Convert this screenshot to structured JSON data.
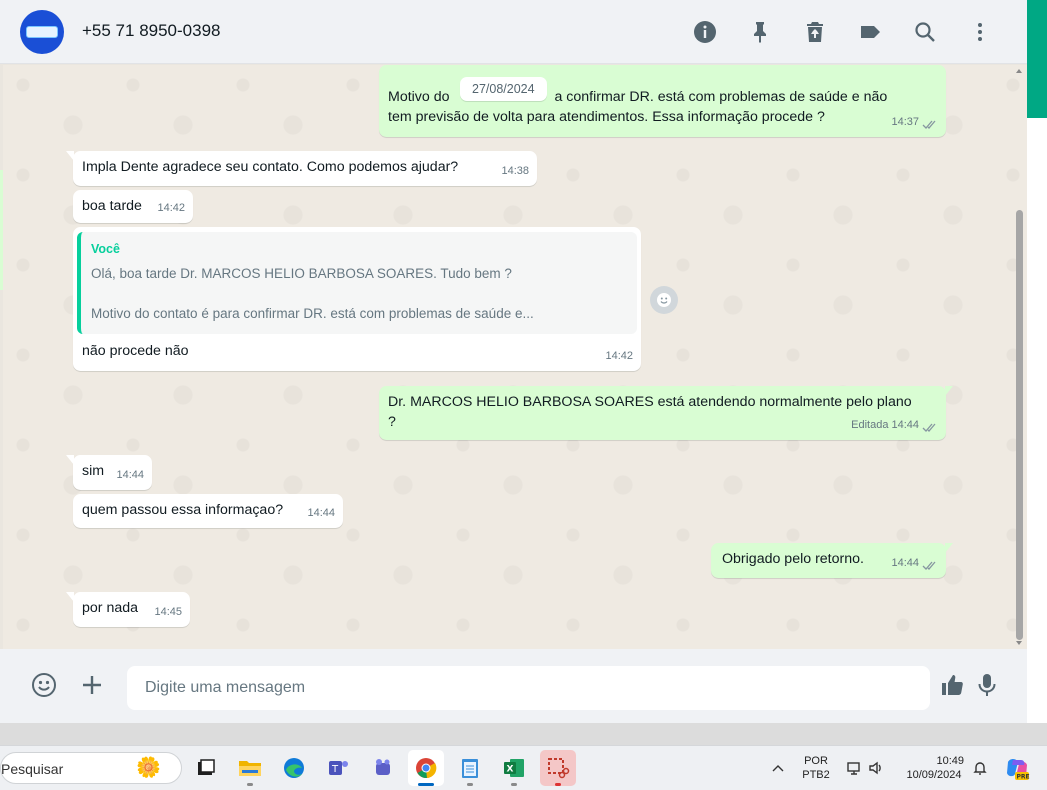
{
  "header": {
    "contact_name": "+55 71 8950-0398",
    "icons": [
      "info-icon",
      "pin-icon",
      "delete-icon",
      "label-icon",
      "search-icon",
      "menu-icon"
    ]
  },
  "chat": {
    "date_chip": "27/08/2024",
    "messages": [
      {
        "dir": "out",
        "text_before": "Motivo do ",
        "text_after": "a confirmar DR. está com problemas de saúde e não",
        "text_line2": "tem previsão de volta para atendimentos. Essa informação procede ?",
        "time": "14:37",
        "edited": ""
      },
      {
        "dir": "in",
        "text": "Impla Dente agradece seu contato. Como podemos ajudar?",
        "time": "14:38"
      },
      {
        "dir": "in",
        "text": "boa tarde",
        "time": "14:42"
      },
      {
        "dir": "in",
        "quote_author": "Você",
        "quote_line1": "Olá, boa tarde Dr. MARCOS HELIO BARBOSA SOARES. Tudo bem ?",
        "quote_line2": "Motivo do contato é para confirmar DR. está com problemas de saúde e...",
        "text": "não procede não",
        "time": "14:42"
      },
      {
        "dir": "out",
        "text": "Dr. MARCOS HELIO BARBOSA SOARES está atendendo normalmente pelo plano",
        "text_line2": "?",
        "time": "14:44",
        "edited": "Editada"
      },
      {
        "dir": "in",
        "text": "sim",
        "time": "14:44"
      },
      {
        "dir": "in",
        "text": "quem passou essa informaçao?",
        "time": "14:44"
      },
      {
        "dir": "out",
        "text": "Obrigado pelo retorno.",
        "time": "14:44",
        "edited": ""
      },
      {
        "dir": "in",
        "text": "por nada",
        "time": "14:45"
      }
    ]
  },
  "compose": {
    "placeholder": "Digite uma mensagem"
  },
  "taskbar": {
    "search_label": "Pesquisar",
    "language_line1": "POR",
    "language_line2": "PTB2",
    "time": "10:49",
    "date": "10/09/2024",
    "copilot_badge": "PRE"
  },
  "colors": {
    "accent": "#00a884",
    "outgoing_bubble": "#d9fdd3",
    "incoming_bubble": "#ffffff",
    "quote_accent": "#06cf9c"
  }
}
